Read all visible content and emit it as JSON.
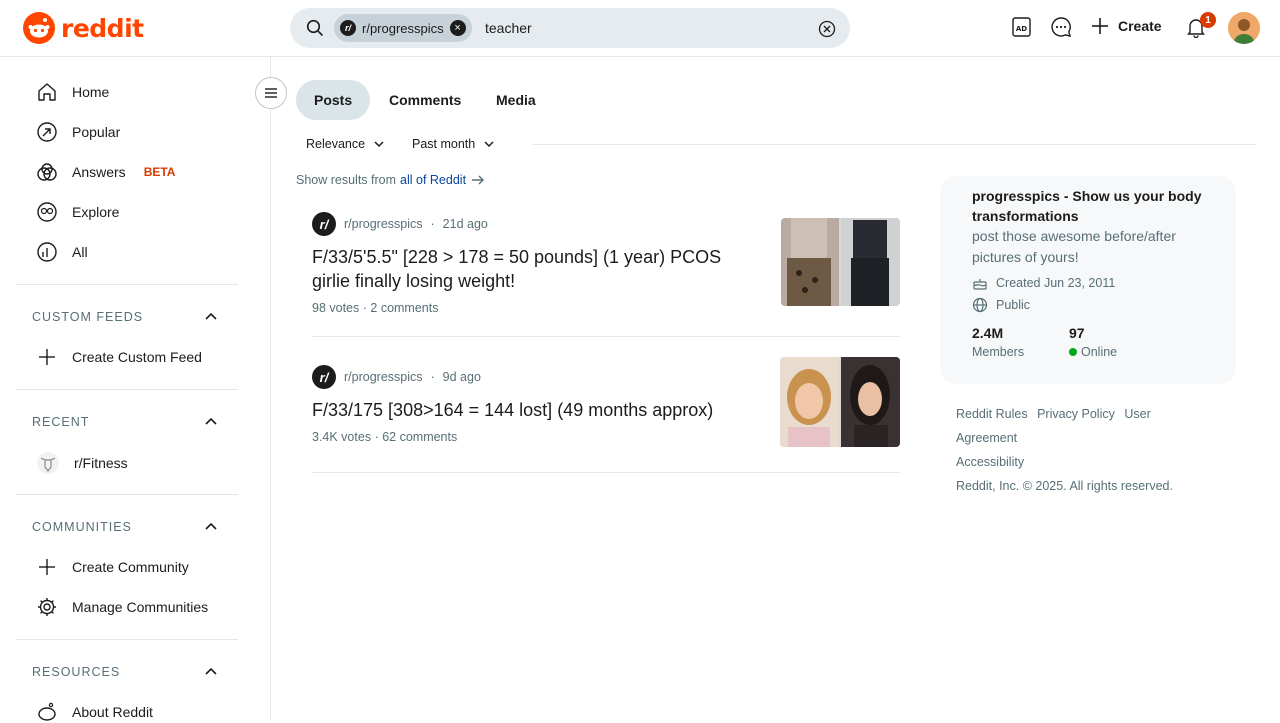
{
  "header": {
    "logo_text": "reddit",
    "search": {
      "scope_chip": "r/progresspics",
      "query": "teacher"
    },
    "create_label": "Create",
    "notification_count": "1"
  },
  "sidebar": {
    "nav": [
      {
        "label": "Home",
        "icon": "home-icon"
      },
      {
        "label": "Popular",
        "icon": "popular-icon"
      },
      {
        "label": "Answers",
        "icon": "answers-icon",
        "badge": "BETA"
      },
      {
        "label": "Explore",
        "icon": "explore-icon"
      },
      {
        "label": "All",
        "icon": "all-icon"
      }
    ],
    "custom_feeds": {
      "title": "CUSTOM FEEDS",
      "items": [
        {
          "label": "Create Custom Feed"
        }
      ]
    },
    "recent": {
      "title": "RECENT",
      "items": [
        {
          "label": "r/Fitness"
        }
      ]
    },
    "communities": {
      "title": "COMMUNITIES",
      "items": [
        {
          "label": "Create Community"
        },
        {
          "label": "Manage Communities"
        }
      ]
    },
    "resources": {
      "title": "RESOURCES",
      "items": [
        {
          "label": "About Reddit"
        }
      ]
    }
  },
  "main": {
    "tabs": [
      {
        "label": "Posts",
        "active": true
      },
      {
        "label": "Comments",
        "active": false
      },
      {
        "label": "Media",
        "active": false
      }
    ],
    "sort": {
      "relevance": "Relevance",
      "time": "Past month"
    },
    "show_results": {
      "prefix": "Show results from",
      "link": "all of Reddit"
    },
    "posts": [
      {
        "subreddit": "r/progresspics",
        "age": "21d ago",
        "title": "F/33/5'5.5\" [228 > 178 = 50 pounds] (1 year) PCOS girlie finally losing weight!",
        "votes": "98 votes",
        "comments": "2 comments"
      },
      {
        "subreddit": "r/progresspics",
        "age": "9d ago",
        "title": "F/33/175 [308>164 = 144 lost] (49 months approx)",
        "votes": "3.4K votes",
        "comments": "62 comments"
      }
    ]
  },
  "community_card": {
    "title": "progresspics - Show us your body transformations",
    "description": "post those awesome before/after pictures of yours!",
    "created": "Created Jun 23, 2011",
    "visibility": "Public",
    "members_count": "2.4M",
    "members_label": "Members",
    "online_count": "97",
    "online_label": "Online"
  },
  "footer": {
    "links": [
      "Reddit Rules",
      "Privacy Policy",
      "User Agreement",
      "Accessibility"
    ],
    "copyright": "Reddit, Inc. © 2025. All rights reserved."
  },
  "colors": {
    "brand": "#ff4500",
    "link": "#0a449b",
    "online": "#01a816",
    "tab_active_bg": "#dbe4e9"
  }
}
